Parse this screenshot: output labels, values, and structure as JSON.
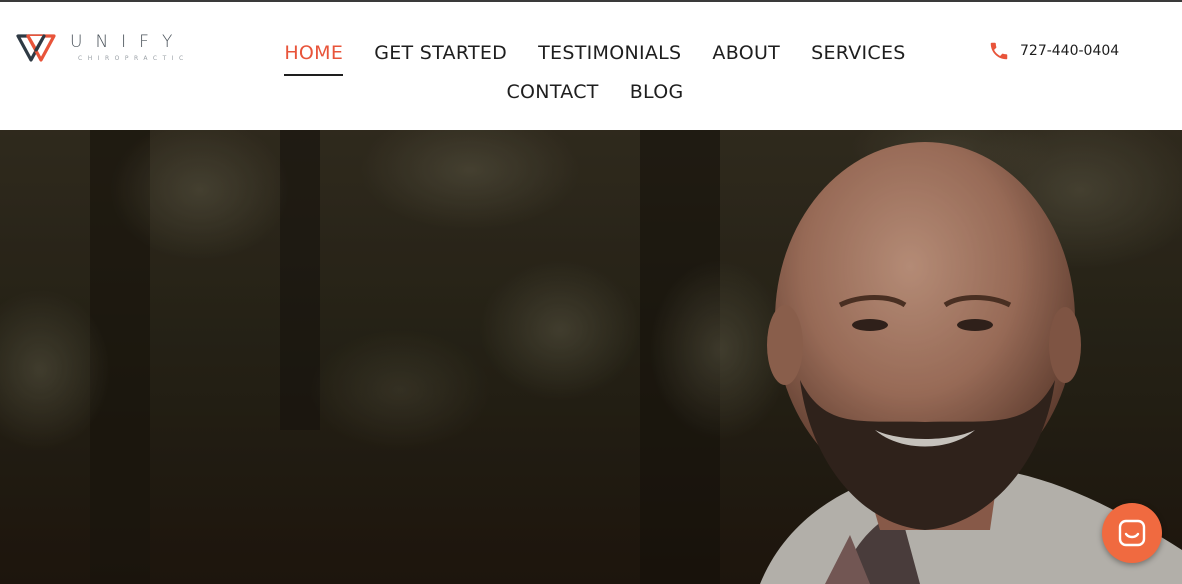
{
  "brand": {
    "name": "UNIFY",
    "tagline": "CHIROPRACTIC",
    "accent": "#e8543a",
    "dark": "#2f3a44"
  },
  "nav": {
    "row1": [
      {
        "label": "HOME",
        "active": true
      },
      {
        "label": "GET STARTED",
        "active": false
      },
      {
        "label": "TESTIMONIALS",
        "active": false
      },
      {
        "label": "ABOUT",
        "active": false
      },
      {
        "label": "SERVICES",
        "active": false
      }
    ],
    "row2": [
      {
        "label": "CONTACT",
        "active": false
      },
      {
        "label": "BLOG",
        "active": false
      }
    ]
  },
  "contact": {
    "phone": "727-440-0404",
    "phone_icon": "phone-icon"
  },
  "hero": {
    "image": "portrait of smiling bald man with beard, blurred trees background"
  },
  "chat": {
    "icon": "chat-icon",
    "color": "#f06a40"
  }
}
